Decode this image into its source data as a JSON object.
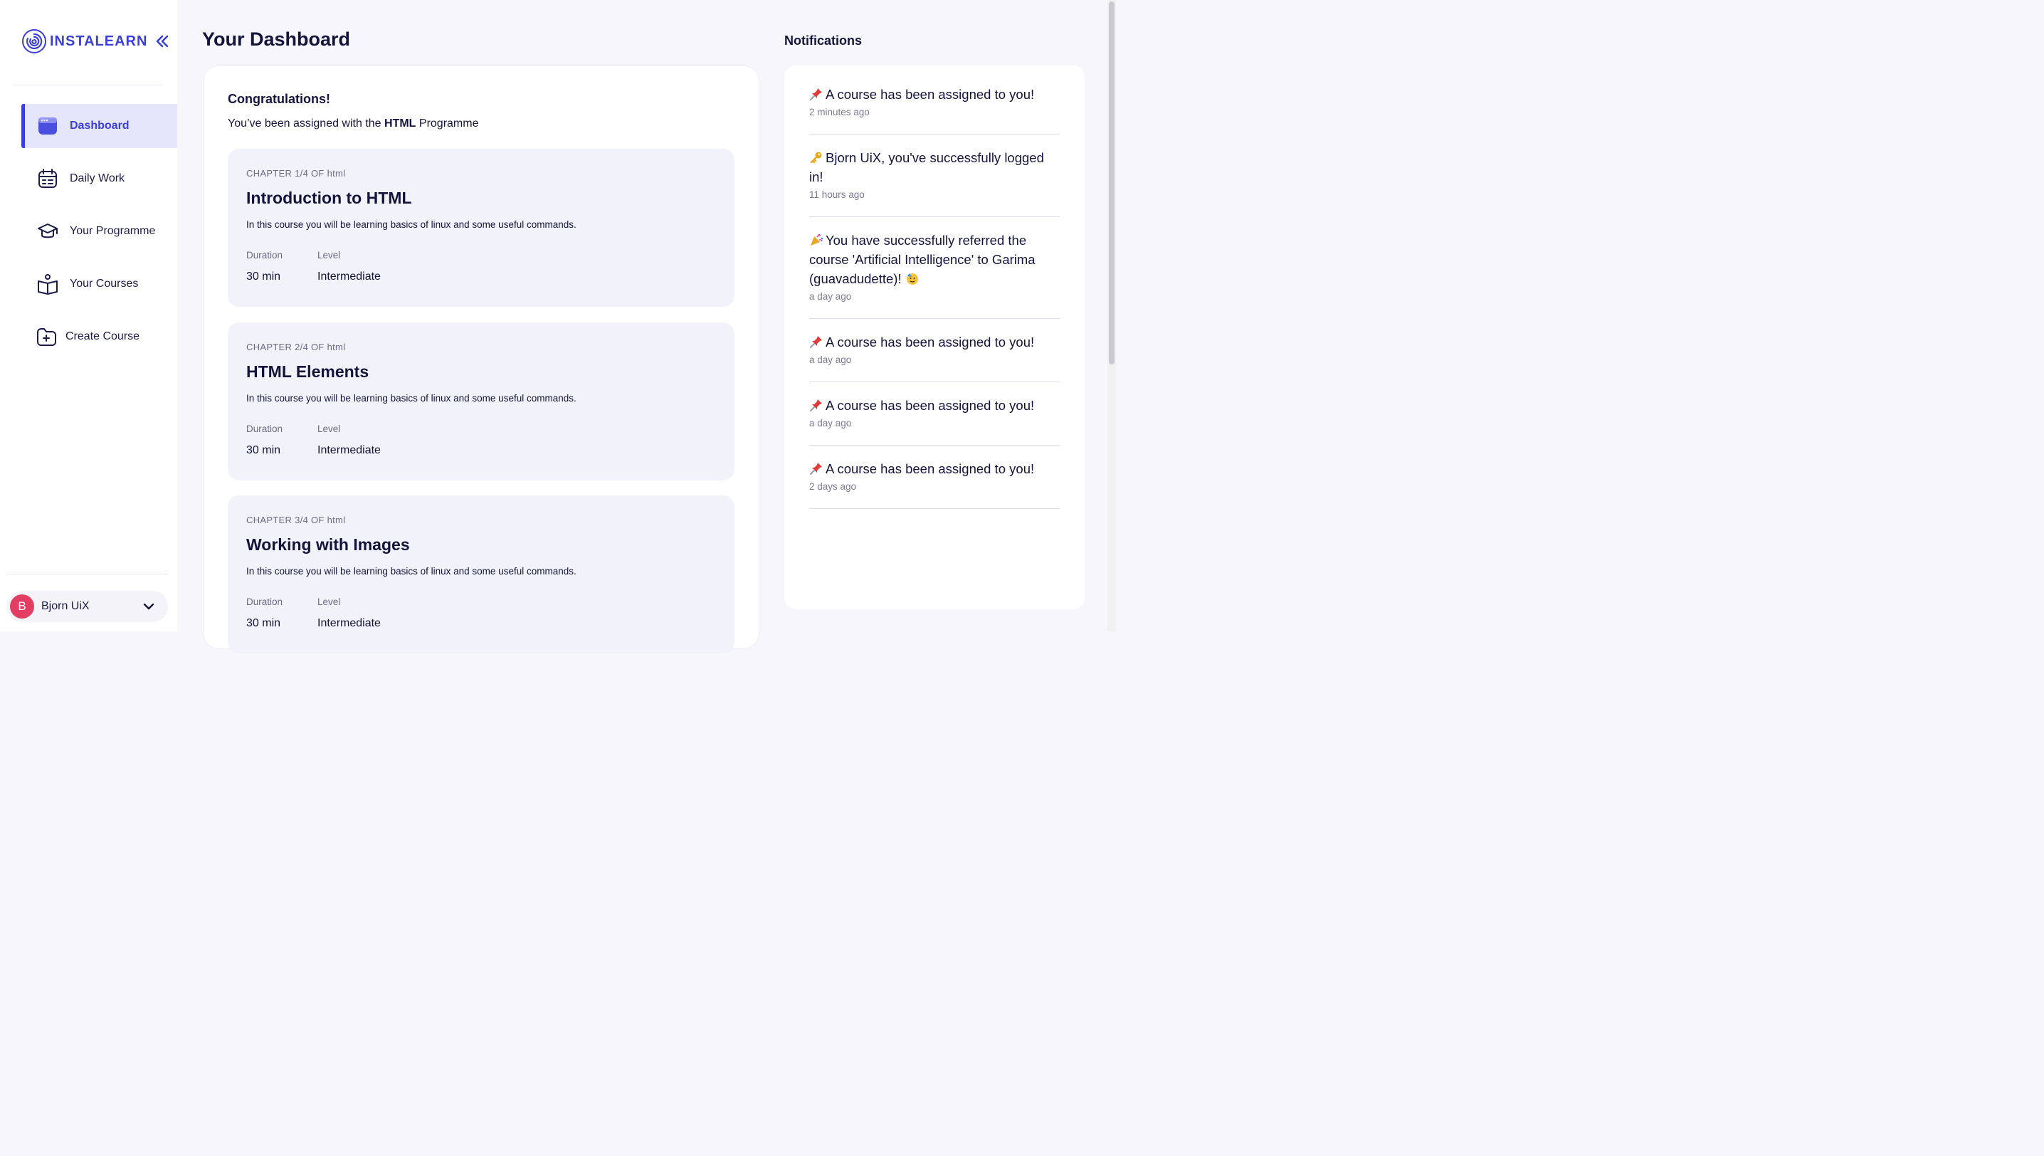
{
  "brand": {
    "name": "INSTALEARN",
    "accent": "#3b3fd8"
  },
  "nav": [
    {
      "label": "Dashboard",
      "icon": "dashboard-icon",
      "active": true
    },
    {
      "label": "Daily Work",
      "icon": "calendar-icon"
    },
    {
      "label": "Your Programme",
      "icon": "graduation-cap-icon"
    },
    {
      "label": "Your Courses",
      "icon": "open-book-icon"
    },
    {
      "label": "Create Course",
      "icon": "folder-plus-icon"
    }
  ],
  "user": {
    "initial": "B",
    "name": "Bjorn UiX",
    "avatar_color": "#e23e63"
  },
  "page_title": "Your Dashboard",
  "main": {
    "congrats": "Congratulations!",
    "assigned_prefix": "You’ve been assigned with the ",
    "programme": "HTML",
    "assigned_suffix": " Programme",
    "chapters": [
      {
        "label": "CHAPTER 1/4 OF html",
        "title": "Introduction to HTML",
        "description": "In this course you will be learning basics of linux and some useful commands.",
        "duration_label": "Duration",
        "duration": "30 min",
        "level_label": "Level",
        "level": "Intermediate"
      },
      {
        "label": "CHAPTER 2/4 OF html",
        "title": "HTML Elements",
        "description": "In this course you will be learning basics of linux and some useful commands.",
        "duration_label": "Duration",
        "duration": "30 min",
        "level_label": "Level",
        "level": "Intermediate"
      },
      {
        "label": "CHAPTER 3/4 OF html",
        "title": "Working with Images",
        "description": "In this course you will be learning basics of linux and some useful commands.",
        "duration_label": "Duration",
        "duration": "30 min",
        "level_label": "Level",
        "level": "Intermediate"
      }
    ]
  },
  "notifications": {
    "title": "Notifications",
    "items": [
      {
        "icon": "pushpin-icon",
        "text": "A course has been assigned to you!",
        "time": "2 minutes ago"
      },
      {
        "icon": "key-icon",
        "text": "Bjorn UiX, you've successfully logged in!",
        "time": "11 hours ago"
      },
      {
        "icon": "party-popper-icon",
        "text": "You have successfully referred the course 'Artificial Intelligence' to Garima (guavadudette)!",
        "trail_icon": "party-face-icon",
        "time": "a day ago"
      },
      {
        "icon": "pushpin-icon",
        "text": "A course has been assigned to you!",
        "time": "a day ago"
      },
      {
        "icon": "pushpin-icon",
        "text": "A course has been assigned to you!",
        "time": "a day ago"
      },
      {
        "icon": "pushpin-icon",
        "text": "A course has been assigned to you!",
        "time": "2 days ago"
      }
    ]
  }
}
